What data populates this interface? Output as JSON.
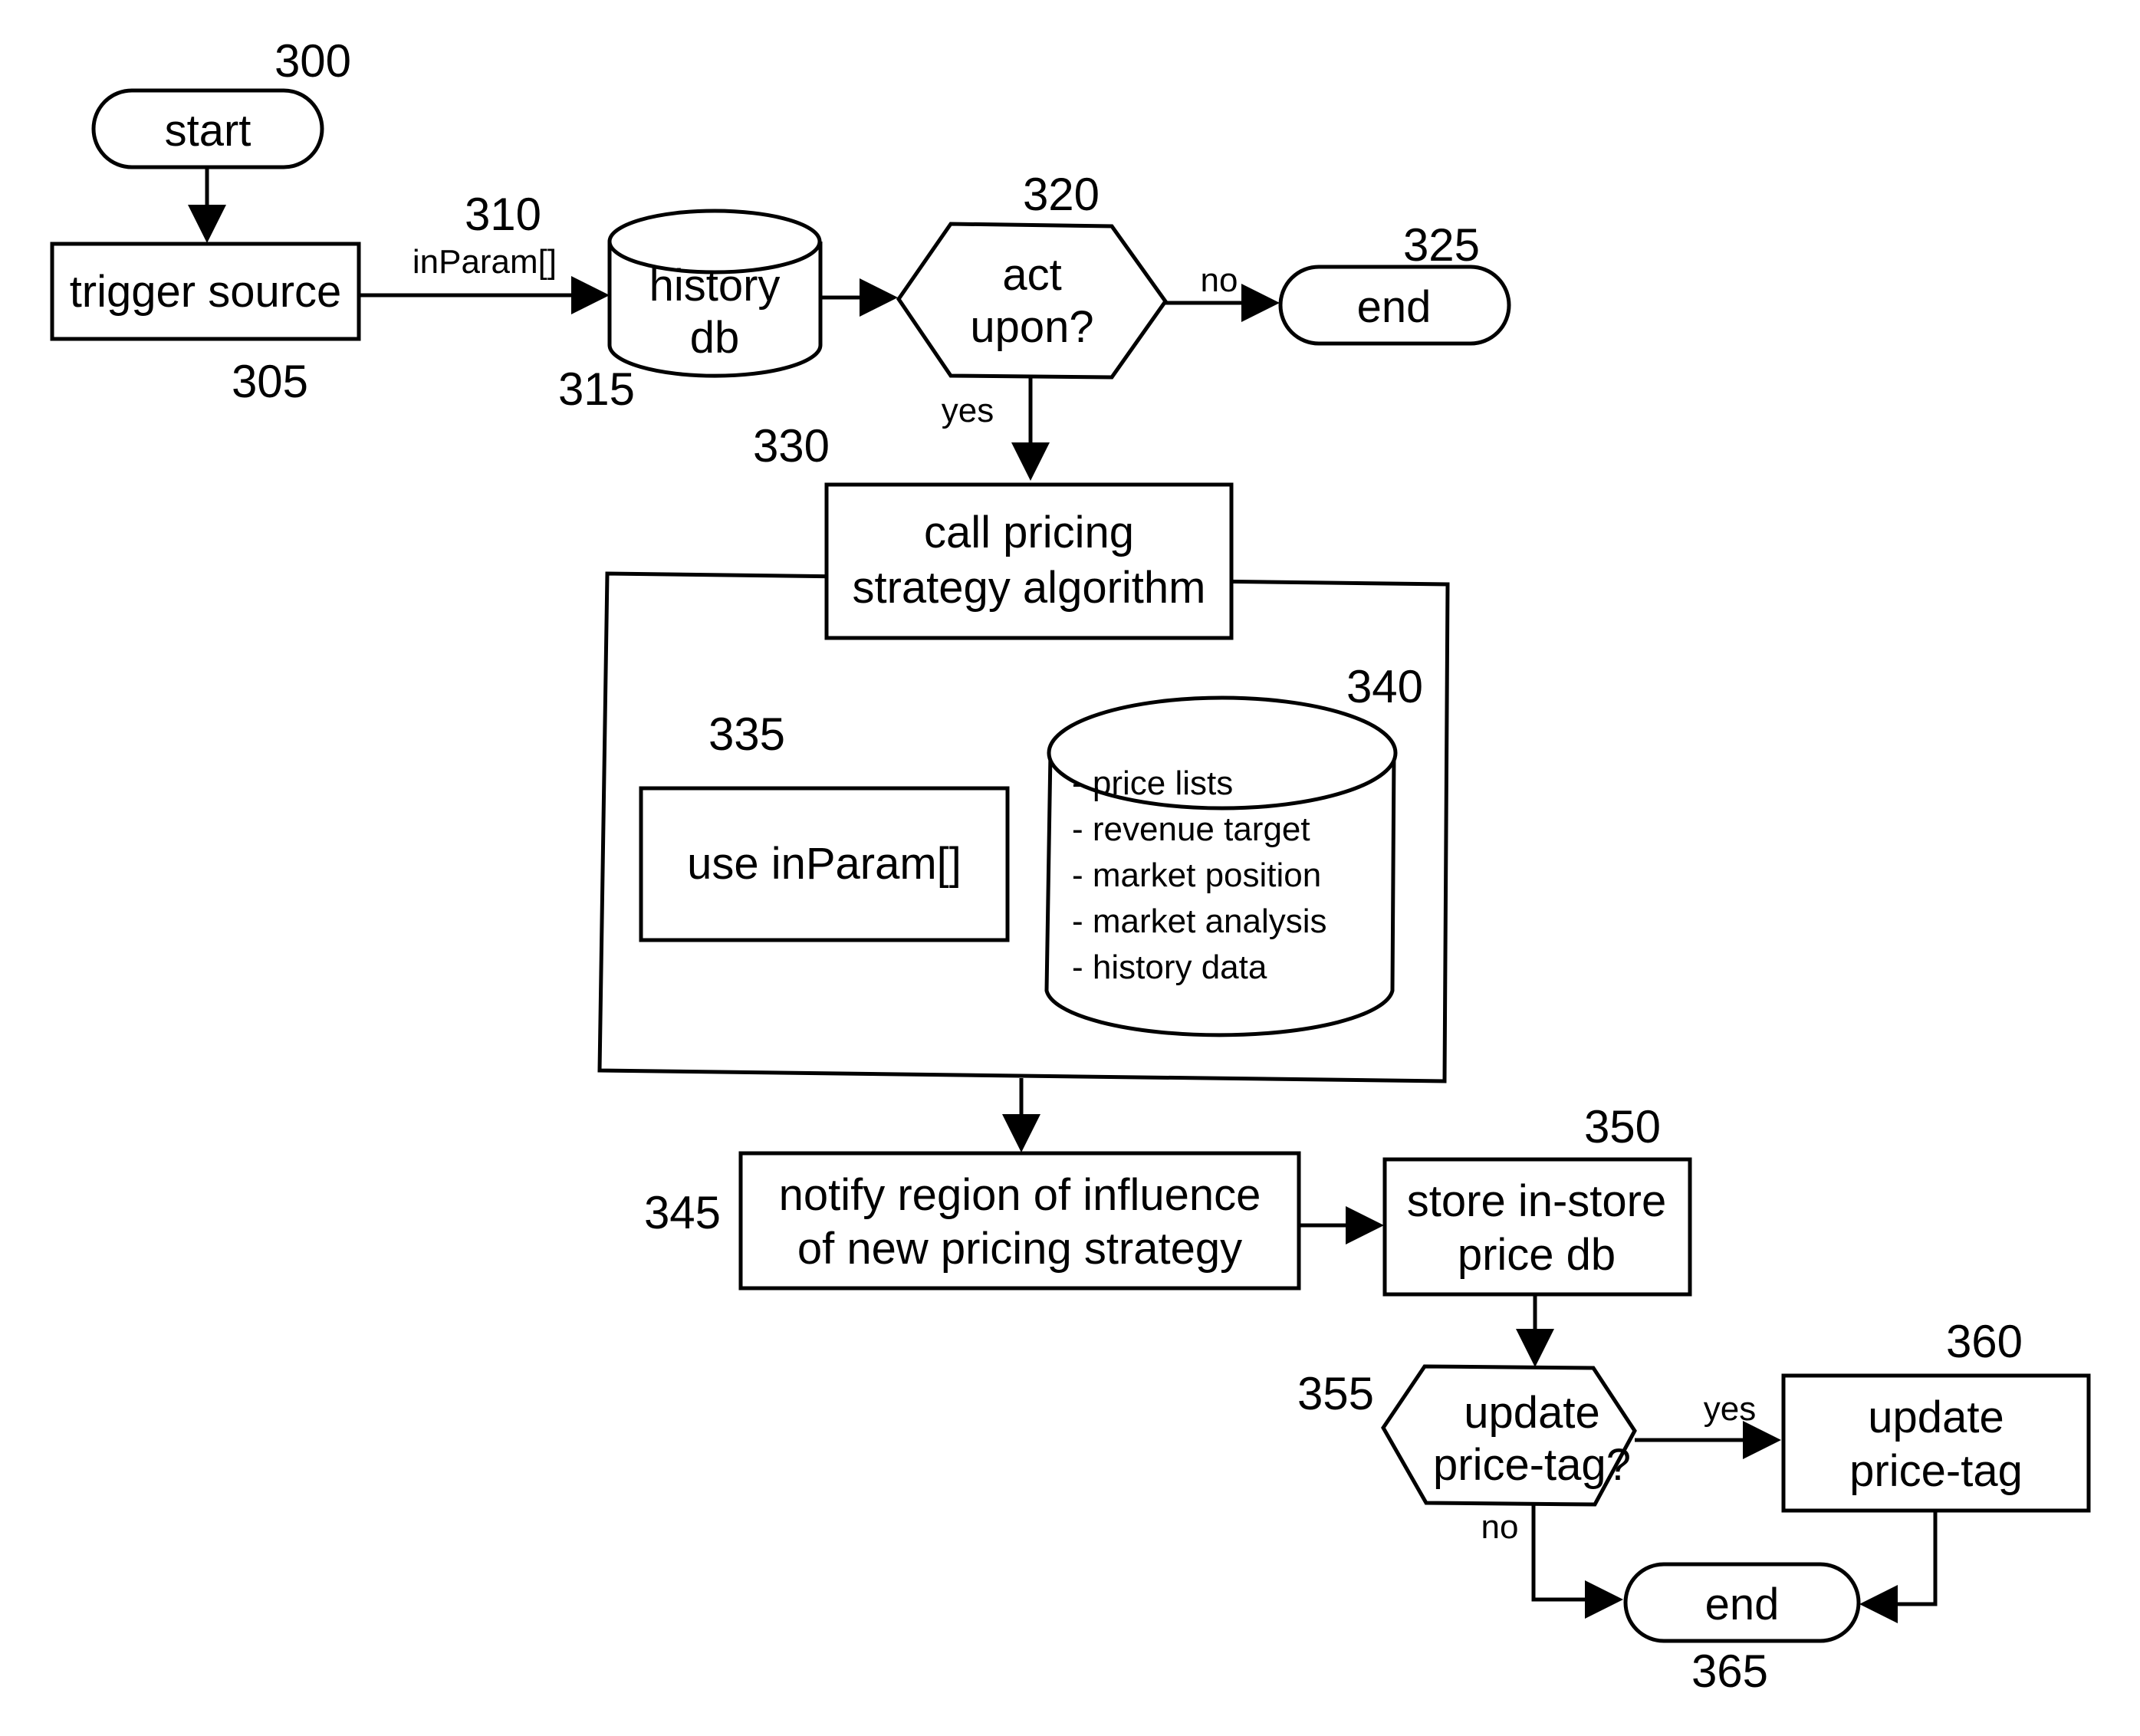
{
  "nodes": {
    "start": {
      "label": "start",
      "ref": "300"
    },
    "trigger": {
      "label": "trigger source",
      "ref": "305"
    },
    "edge_inparam": {
      "label": "inParam[]",
      "ref": "310"
    },
    "history": {
      "line1": "history",
      "line2": "db",
      "ref": "315"
    },
    "act": {
      "line1": "act",
      "line2": "upon?",
      "ref": "320"
    },
    "end1": {
      "label": "end",
      "ref": "325"
    },
    "call": {
      "line1": "call pricing",
      "line2": "strategy algorithm",
      "ref": "330"
    },
    "use": {
      "label": "use inParam[]",
      "ref": "335"
    },
    "db340": {
      "ref": "340",
      "items": [
        "- price lists",
        "- revenue target",
        "- market position",
        "- market analysis",
        "- history data"
      ]
    },
    "notify": {
      "line1": "notify region of influence",
      "line2": "of new pricing strategy",
      "ref": "345"
    },
    "store": {
      "line1": "store in-store",
      "line2": "price db",
      "ref": "350"
    },
    "update_q": {
      "line1": "update",
      "line2": "price-tag?",
      "ref": "355"
    },
    "update": {
      "line1": "update",
      "line2": "price-tag",
      "ref": "360"
    },
    "end2": {
      "label": "end",
      "ref": "365"
    }
  },
  "edge_labels": {
    "act_no": "no",
    "act_yes": "yes",
    "upd_yes": "yes",
    "upd_no": "no"
  }
}
